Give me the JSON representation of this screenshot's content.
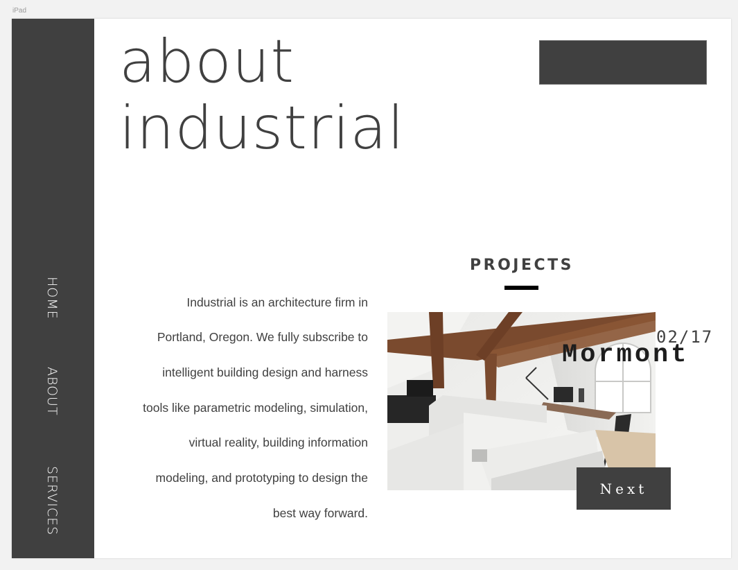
{
  "device_label": "iPad",
  "sidebar": {
    "items": [
      {
        "label": "HOME"
      },
      {
        "label": "ABOUT"
      },
      {
        "label": "SERVICES"
      }
    ]
  },
  "hero": {
    "title_line1": "about",
    "title_line2": "industrial"
  },
  "intro": {
    "lines": [
      "Industrial is an architecture firm in",
      "Portland, Oregon.  We fully subscribe to",
      "intelligent building design and harness",
      "tools like parametric modeling, simulation,",
      "virtual reality, building information",
      "modeling, and prototyping to design the",
      "best way forward."
    ]
  },
  "projects": {
    "heading": "PROJECTS",
    "counter": "02/17",
    "name": "Mormont",
    "next_label": "Next"
  },
  "colors": {
    "dark_gray": "#404040",
    "white": "#ffffff",
    "black": "#000000"
  }
}
